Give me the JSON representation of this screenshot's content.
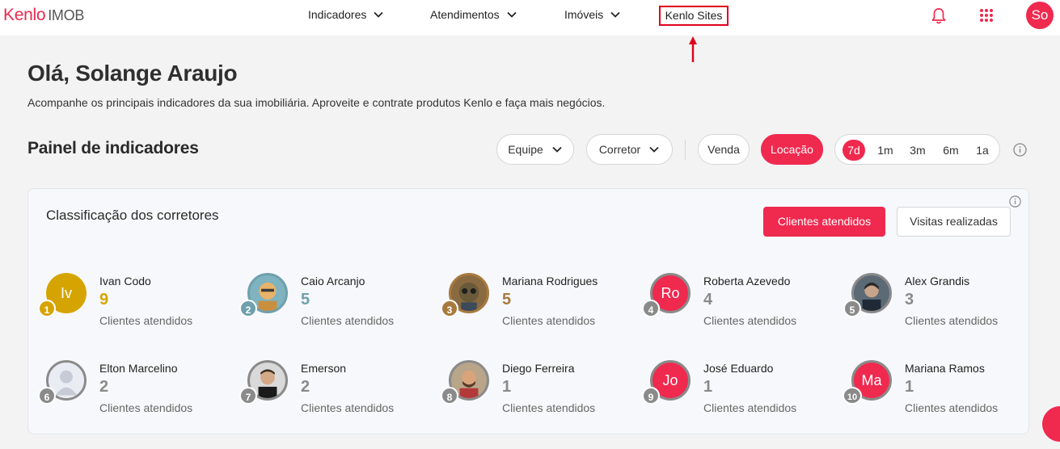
{
  "header": {
    "logo_brand": "Kenlo",
    "logo_product": "IMOB",
    "nav": [
      {
        "label": "Indicadores"
      },
      {
        "label": "Atendimentos"
      },
      {
        "label": "Imóveis"
      },
      {
        "label": "Kenlo Sites"
      }
    ],
    "user_initials": "So",
    "icons": [
      "chevron-down-icon",
      "bell-icon",
      "apps-grid-icon",
      "arrow-up-icon"
    ]
  },
  "greeting": {
    "title": "Olá, Solange Araujo",
    "subtitle": "Acompanhe os principais indicadores da sua imobiliária. Aproveite e contrate produtos Kenlo e faça mais negócios."
  },
  "panel": {
    "title": "Painel de indicadores",
    "filters": {
      "team": "Equipe",
      "broker": "Corretor"
    },
    "modes": {
      "sale": "Venda",
      "rent": "Locação",
      "selected": "Locação"
    },
    "periods": [
      "7d",
      "1m",
      "3m",
      "6m",
      "1a"
    ],
    "selected_period": "7d"
  },
  "ranking": {
    "title": "Classificação dos corretores",
    "tabs": {
      "primary": "Clientes atendidos",
      "secondary": "Visitas realizadas"
    },
    "metric_label": "Clientes atendidos",
    "items": [
      {
        "rank": "1",
        "name": "Ivan Codo",
        "count": "9",
        "initials": "Iv"
      },
      {
        "rank": "2",
        "name": "Caio Arcanjo",
        "count": "5",
        "initials": ""
      },
      {
        "rank": "3",
        "name": "Mariana Rodrigues",
        "count": "5",
        "initials": ""
      },
      {
        "rank": "4",
        "name": "Roberta Azevedo",
        "count": "4",
        "initials": "Ro"
      },
      {
        "rank": "5",
        "name": "Alex Grandis",
        "count": "3",
        "initials": ""
      },
      {
        "rank": "6",
        "name": "Elton Marcelino",
        "count": "2",
        "initials": ""
      },
      {
        "rank": "7",
        "name": "Emerson",
        "count": "2",
        "initials": ""
      },
      {
        "rank": "8",
        "name": "Diego Ferreira",
        "count": "1",
        "initials": ""
      },
      {
        "rank": "9",
        "name": "José Eduardo",
        "count": "1",
        "initials": "Jo"
      },
      {
        "rank": "10",
        "name": "Mariana Ramos",
        "count": "1",
        "initials": "Ma"
      }
    ]
  },
  "colors": {
    "accent": "#f0294f",
    "gold": "#d6a400",
    "teal": "#6fa0ad",
    "bronze": "#a87a3f",
    "grey": "#8a8a8a"
  }
}
